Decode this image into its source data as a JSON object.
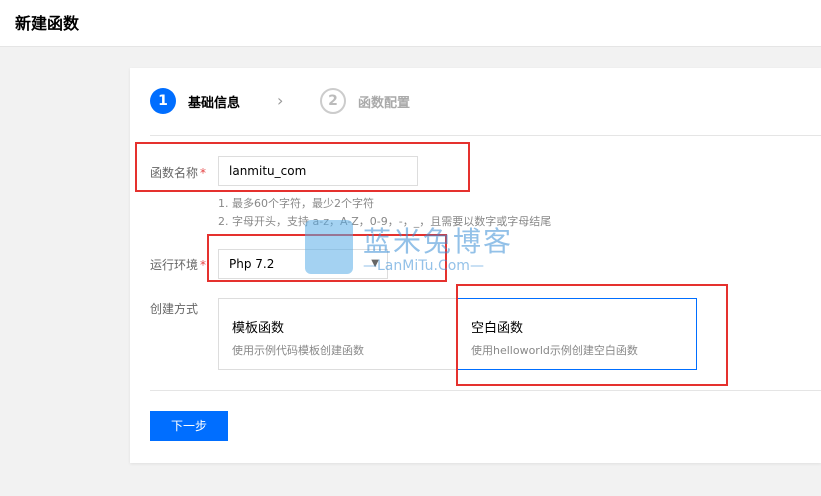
{
  "header": {
    "title": "新建函数"
  },
  "steps": [
    {
      "number": "1",
      "label": "基础信息",
      "active": true
    },
    {
      "number": "2",
      "label": "函数配置",
      "active": false
    }
  ],
  "form": {
    "name_label": "函数名称",
    "name_value": "lanmitu_com",
    "hints": [
      "1. 最多60个字符，最少2个字符",
      "2. 字母开头，支持 a-z，A-Z，0-9，-，_，且需要以数字或字母结尾"
    ],
    "runtime_label": "运行环境",
    "runtime_value": "Php 7.2",
    "method_label": "创建方式",
    "options": [
      {
        "title": "模板函数",
        "desc": "使用示例代码模板创建函数",
        "selected": false
      },
      {
        "title": "空白函数",
        "desc": "使用helloworld示例创建空白函数",
        "selected": true
      }
    ],
    "required_mark": "*"
  },
  "actions": {
    "next_label": "下一步"
  },
  "watermark": {
    "cn": "蓝米兔博客",
    "en": "—LanMiTu.Com—"
  },
  "colors": {
    "accent": "#006eff",
    "highlight": "#e5312e"
  }
}
